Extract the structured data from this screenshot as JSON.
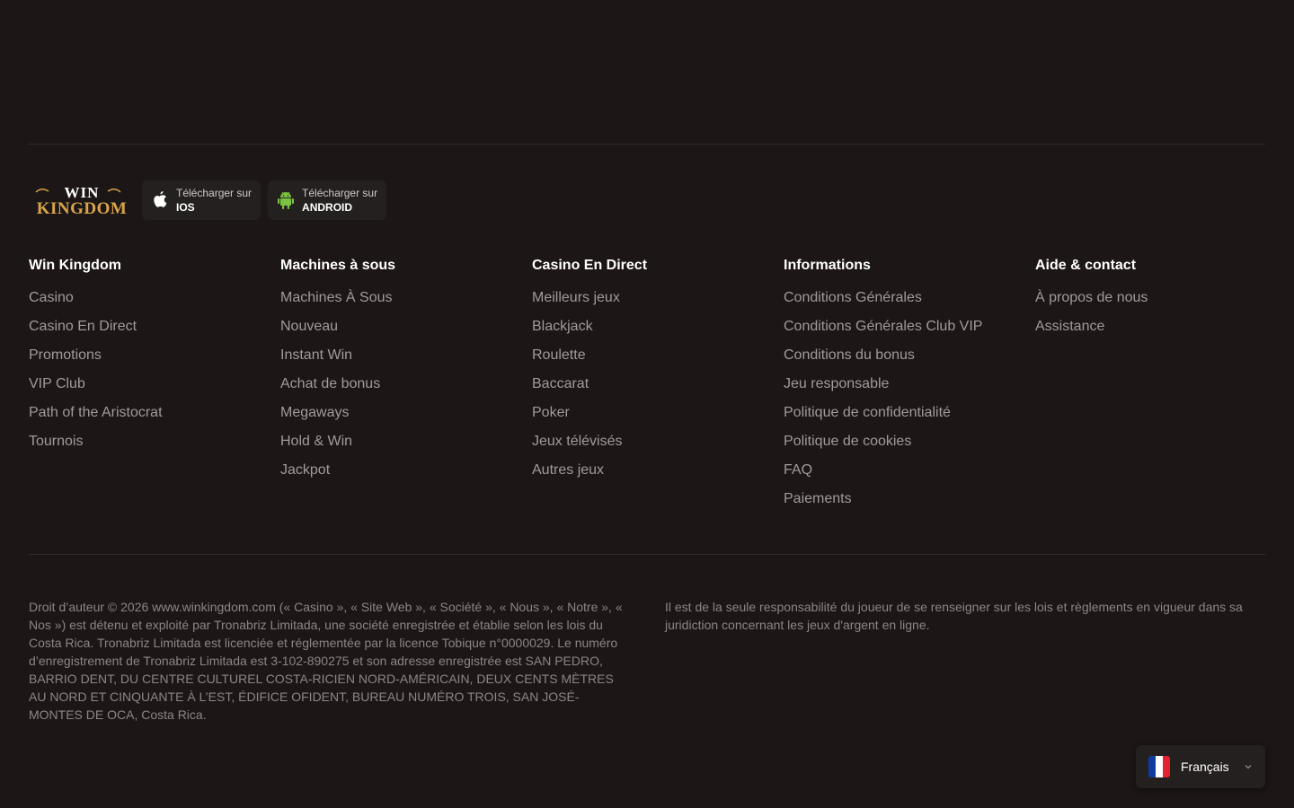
{
  "brand": {
    "logo_line1": "WIN",
    "logo_line2": "KINGDOM"
  },
  "apps": [
    {
      "prefix": "Télécharger sur",
      "platform": "IOS",
      "icon": "apple-icon"
    },
    {
      "prefix": "Télécharger sur",
      "platform": "ANDROID",
      "icon": "android-icon"
    }
  ],
  "columns": [
    {
      "title": "Win Kingdom",
      "links": [
        "Casino",
        "Casino En Direct",
        "Promotions",
        "VIP Club",
        "Path of the Aristocrat",
        "Tournois"
      ]
    },
    {
      "title": "Machines à sous",
      "links": [
        "Machines À Sous",
        "Nouveau",
        "Instant Win",
        "Achat de bonus",
        "Megaways",
        "Hold & Win",
        "Jackpot"
      ]
    },
    {
      "title": "Casino En Direct",
      "links": [
        "Meilleurs jeux",
        "Blackjack",
        "Roulette",
        "Baccarat",
        "Poker",
        "Jeux télévisés",
        "Autres jeux"
      ]
    },
    {
      "title": "Informations",
      "links": [
        "Conditions Générales",
        "Conditions Générales Club VIP",
        "Conditions du bonus",
        "Jeu responsable",
        "Politique de confidentialité",
        "Politique de cookies",
        "FAQ",
        "Paiements"
      ]
    },
    {
      "title": "Aide & contact",
      "links": [
        "À propos de nous",
        "Assistance"
      ]
    }
  ],
  "legal": {
    "copyright": "Droit d’auteur © 2026 www.winkingdom.com (« Casino », « Site Web », « Société », « Nous », « Notre », « Nos ») est détenu et exploité par Tronabriz Limitada, une société enregistrée et établie selon les lois du Costa Rica. Tronabriz Limitada est licenciée et réglementée par la licence Tobique n°0000029. Le numéro d’enregistrement de Tronabriz Limitada est 3-102-890275 et son adresse enregistrée est SAN PEDRO, BARRIO DENT, DU CENTRE CULTUREL COSTA-RICIEN NORD-AMÉRICAIN, DEUX CENTS MÈTRES AU NORD ET CINQUANTE À L’EST, ÉDIFICE OFIDENT, BUREAU NUMÉRO TROIS, SAN JOSÉ-MONTES DE OCA, Costa Rica.",
    "responsibility": "Il est de la seule responsabilité du joueur de se renseigner sur les lois et règlements en vigueur dans sa juridiction concernant les jeux d'argent en ligne."
  },
  "language": {
    "selected": "Français",
    "flag_icon": "france-flag-icon"
  },
  "colors": {
    "background": "#1c1616",
    "logo_gold": "#d9a54a",
    "android_green": "#7cc242",
    "link_grey": "#a39a9a"
  }
}
